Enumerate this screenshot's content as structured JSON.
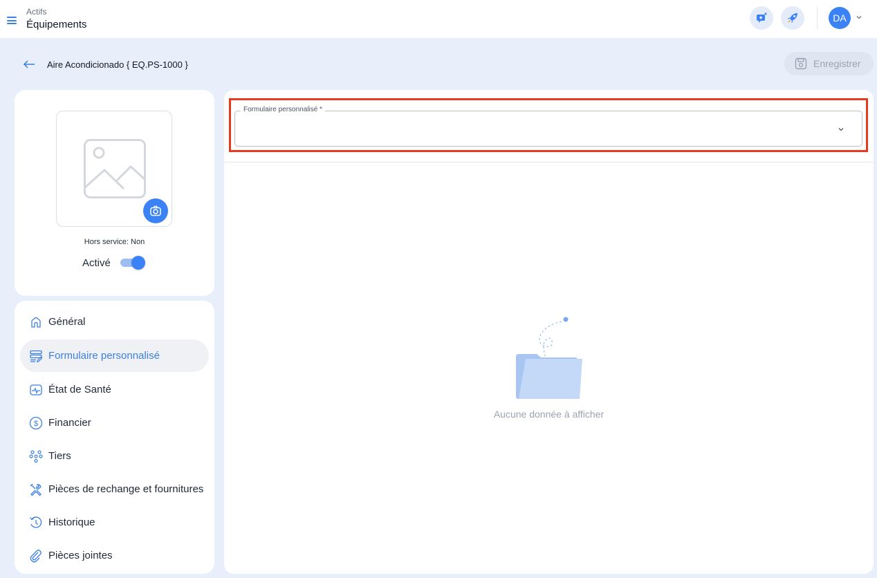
{
  "header": {
    "breadcrumb_parent": "Actifs",
    "page_title": "Équipements",
    "user_initials": "DA"
  },
  "toolbar": {
    "asset_title": "Aire Acondicionado { EQ.PS-1000 }",
    "save_label": "Enregistrer"
  },
  "profile": {
    "out_of_service": "Hors service: Non",
    "active_label": "Activé",
    "active": true
  },
  "nav": {
    "items": [
      {
        "label": "Général",
        "icon": "home-icon"
      },
      {
        "label": "Formulaire personnalisé",
        "icon": "form-icon",
        "active": true
      },
      {
        "label": "État de Santé",
        "icon": "health-monitor-icon"
      },
      {
        "label": "Financier",
        "icon": "dollar-icon"
      },
      {
        "label": "Tiers",
        "icon": "network-icon"
      },
      {
        "label": "Pièces de rechange et fournitures",
        "icon": "tools-icon"
      },
      {
        "label": "Historique",
        "icon": "history-icon"
      },
      {
        "label": "Pièces jointes",
        "icon": "paperclip-icon"
      }
    ]
  },
  "main": {
    "custom_form_label": "Formulaire personnalisé *",
    "custom_form_value": "",
    "empty_message": "Aucune donnée à afficher"
  },
  "colors": {
    "accent": "#3b82f6",
    "highlight": "#e63a1f",
    "page_background": "#e8effa"
  }
}
